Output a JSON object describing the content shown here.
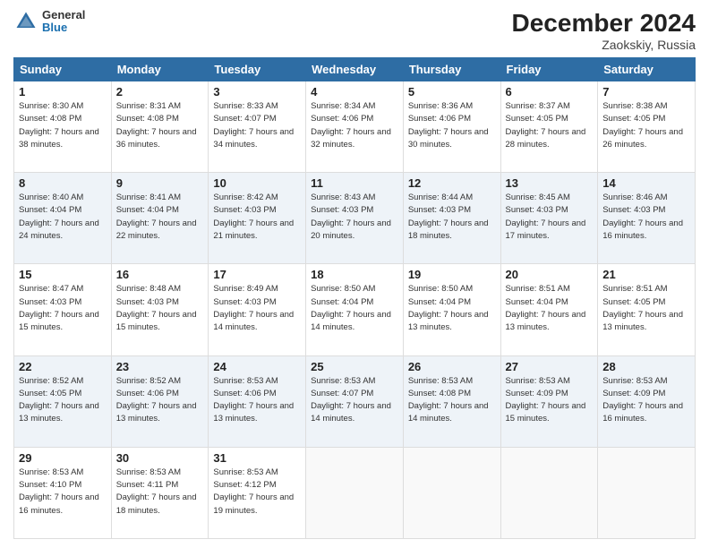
{
  "header": {
    "logo_general": "General",
    "logo_blue": "Blue",
    "month_year": "December 2024",
    "location": "Zaokskiy, Russia"
  },
  "days_of_week": [
    "Sunday",
    "Monday",
    "Tuesday",
    "Wednesday",
    "Thursday",
    "Friday",
    "Saturday"
  ],
  "weeks": [
    [
      {
        "day": 1,
        "sunrise": "8:30 AM",
        "sunset": "4:08 PM",
        "daylight": "7 hours and 38 minutes."
      },
      {
        "day": 2,
        "sunrise": "8:31 AM",
        "sunset": "4:08 PM",
        "daylight": "7 hours and 36 minutes."
      },
      {
        "day": 3,
        "sunrise": "8:33 AM",
        "sunset": "4:07 PM",
        "daylight": "7 hours and 34 minutes."
      },
      {
        "day": 4,
        "sunrise": "8:34 AM",
        "sunset": "4:06 PM",
        "daylight": "7 hours and 32 minutes."
      },
      {
        "day": 5,
        "sunrise": "8:36 AM",
        "sunset": "4:06 PM",
        "daylight": "7 hours and 30 minutes."
      },
      {
        "day": 6,
        "sunrise": "8:37 AM",
        "sunset": "4:05 PM",
        "daylight": "7 hours and 28 minutes."
      },
      {
        "day": 7,
        "sunrise": "8:38 AM",
        "sunset": "4:05 PM",
        "daylight": "7 hours and 26 minutes."
      }
    ],
    [
      {
        "day": 8,
        "sunrise": "8:40 AM",
        "sunset": "4:04 PM",
        "daylight": "7 hours and 24 minutes."
      },
      {
        "day": 9,
        "sunrise": "8:41 AM",
        "sunset": "4:04 PM",
        "daylight": "7 hours and 22 minutes."
      },
      {
        "day": 10,
        "sunrise": "8:42 AM",
        "sunset": "4:03 PM",
        "daylight": "7 hours and 21 minutes."
      },
      {
        "day": 11,
        "sunrise": "8:43 AM",
        "sunset": "4:03 PM",
        "daylight": "7 hours and 20 minutes."
      },
      {
        "day": 12,
        "sunrise": "8:44 AM",
        "sunset": "4:03 PM",
        "daylight": "7 hours and 18 minutes."
      },
      {
        "day": 13,
        "sunrise": "8:45 AM",
        "sunset": "4:03 PM",
        "daylight": "7 hours and 17 minutes."
      },
      {
        "day": 14,
        "sunrise": "8:46 AM",
        "sunset": "4:03 PM",
        "daylight": "7 hours and 16 minutes."
      }
    ],
    [
      {
        "day": 15,
        "sunrise": "8:47 AM",
        "sunset": "4:03 PM",
        "daylight": "7 hours and 15 minutes."
      },
      {
        "day": 16,
        "sunrise": "8:48 AM",
        "sunset": "4:03 PM",
        "daylight": "7 hours and 15 minutes."
      },
      {
        "day": 17,
        "sunrise": "8:49 AM",
        "sunset": "4:03 PM",
        "daylight": "7 hours and 14 minutes."
      },
      {
        "day": 18,
        "sunrise": "8:50 AM",
        "sunset": "4:04 PM",
        "daylight": "7 hours and 14 minutes."
      },
      {
        "day": 19,
        "sunrise": "8:50 AM",
        "sunset": "4:04 PM",
        "daylight": "7 hours and 13 minutes."
      },
      {
        "day": 20,
        "sunrise": "8:51 AM",
        "sunset": "4:04 PM",
        "daylight": "7 hours and 13 minutes."
      },
      {
        "day": 21,
        "sunrise": "8:51 AM",
        "sunset": "4:05 PM",
        "daylight": "7 hours and 13 minutes."
      }
    ],
    [
      {
        "day": 22,
        "sunrise": "8:52 AM",
        "sunset": "4:05 PM",
        "daylight": "7 hours and 13 minutes."
      },
      {
        "day": 23,
        "sunrise": "8:52 AM",
        "sunset": "4:06 PM",
        "daylight": "7 hours and 13 minutes."
      },
      {
        "day": 24,
        "sunrise": "8:53 AM",
        "sunset": "4:06 PM",
        "daylight": "7 hours and 13 minutes."
      },
      {
        "day": 25,
        "sunrise": "8:53 AM",
        "sunset": "4:07 PM",
        "daylight": "7 hours and 14 minutes."
      },
      {
        "day": 26,
        "sunrise": "8:53 AM",
        "sunset": "4:08 PM",
        "daylight": "7 hours and 14 minutes."
      },
      {
        "day": 27,
        "sunrise": "8:53 AM",
        "sunset": "4:09 PM",
        "daylight": "7 hours and 15 minutes."
      },
      {
        "day": 28,
        "sunrise": "8:53 AM",
        "sunset": "4:09 PM",
        "daylight": "7 hours and 16 minutes."
      }
    ],
    [
      {
        "day": 29,
        "sunrise": "8:53 AM",
        "sunset": "4:10 PM",
        "daylight": "7 hours and 16 minutes."
      },
      {
        "day": 30,
        "sunrise": "8:53 AM",
        "sunset": "4:11 PM",
        "daylight": "7 hours and 18 minutes."
      },
      {
        "day": 31,
        "sunrise": "8:53 AM",
        "sunset": "4:12 PM",
        "daylight": "7 hours and 19 minutes."
      },
      null,
      null,
      null,
      null
    ]
  ]
}
